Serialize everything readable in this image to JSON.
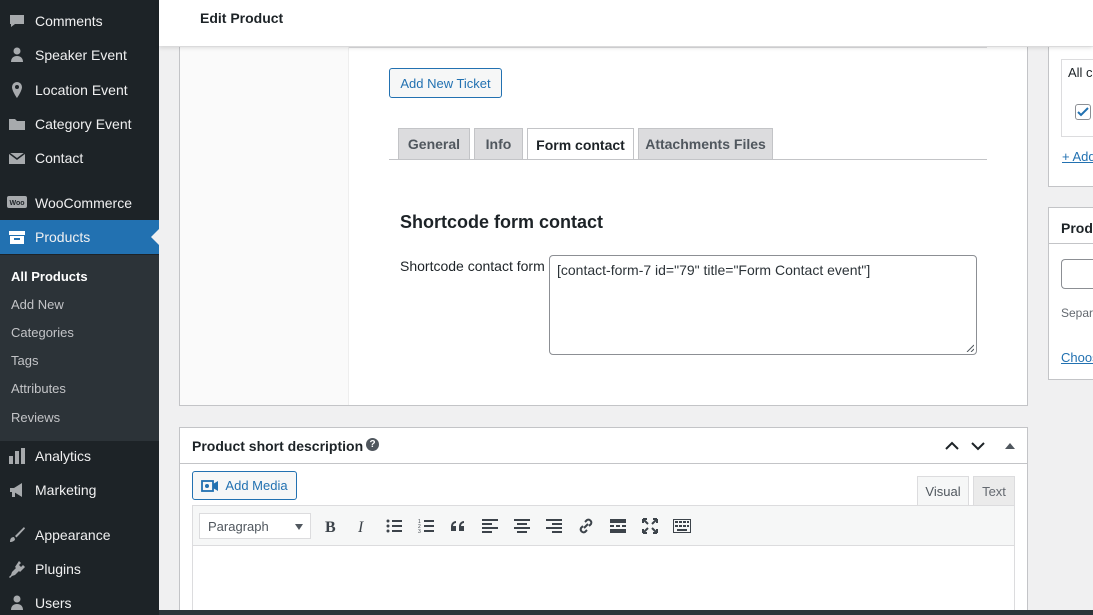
{
  "sidebar": {
    "items": [
      {
        "label": "Comments",
        "icon": "comments-icon"
      },
      {
        "label": "Speaker Event",
        "icon": "user-icon"
      },
      {
        "label": "Location Event",
        "icon": "location-pin-icon"
      },
      {
        "label": "Category Event",
        "icon": "folder-icon"
      },
      {
        "label": "Contact",
        "icon": "envelope-icon"
      },
      {
        "label": "WooCommerce",
        "icon": "woocommerce-icon"
      },
      {
        "label": "Products",
        "icon": "archive-box-icon"
      },
      {
        "label": "Analytics",
        "icon": "bar-chart-icon"
      },
      {
        "label": "Marketing",
        "icon": "megaphone-icon"
      },
      {
        "label": "Appearance",
        "icon": "paintbrush-icon"
      },
      {
        "label": "Plugins",
        "icon": "plug-icon"
      },
      {
        "label": "Users",
        "icon": "users-icon"
      }
    ],
    "submenu": [
      "All Products",
      "Add New",
      "Categories",
      "Tags",
      "Attributes",
      "Reviews"
    ]
  },
  "header": {
    "title": "Edit Product"
  },
  "product_data": {
    "add_ticket_label": "Add New Ticket",
    "tabs": [
      "General",
      "Info",
      "Form contact",
      "Attachments Files"
    ],
    "section_title": "Shortcode form contact",
    "field_label": "Shortcode contact form",
    "field_value": "[contact-form-7 id=\"79\" title=\"Form Contact event\"]"
  },
  "short_description": {
    "title": "Product short description",
    "help": "?",
    "add_media_label": "Add Media",
    "tab_visual": "Visual",
    "tab_text": "Text",
    "format_value": "Paragraph",
    "toolbar_icons": [
      "bold-icon",
      "italic-icon",
      "bullet-list-icon",
      "numbered-list-icon",
      "blockquote-icon",
      "align-left-icon",
      "align-center-icon",
      "align-right-icon",
      "link-icon",
      "read-more-icon",
      "fullscreen-icon",
      "toolbar-toggle-icon"
    ]
  },
  "right_panel": {
    "box1_text": "All ca",
    "box1_link": "+ Add",
    "box2_title": "Produ",
    "box2_sep": "Separ",
    "box2_link": "Choos"
  },
  "colors": {
    "sidebar_bg": "#1d2327",
    "accent": "#2271b1",
    "submenu_bg": "#2c3338"
  }
}
